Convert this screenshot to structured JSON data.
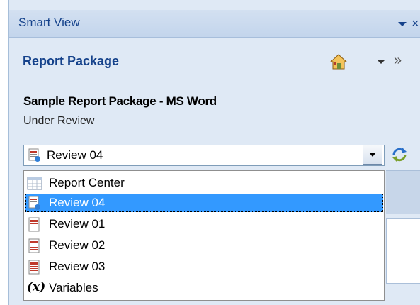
{
  "window": {
    "title": "Smart View",
    "close_glyph": "×"
  },
  "header": {
    "title": "Report Package",
    "more_glyph": "»"
  },
  "package": {
    "name": "Sample Report Package - MS Word",
    "status": "Under Review"
  },
  "combo": {
    "selected": "Review 04"
  },
  "dropdown": {
    "items": [
      {
        "label": "Report Center",
        "icon": "report-center-icon"
      },
      {
        "label": "Review 04",
        "icon": "review-doc-icon",
        "selected": true
      },
      {
        "label": "Review 01",
        "icon": "word-doc-icon"
      },
      {
        "label": "Review 02",
        "icon": "word-doc-icon"
      },
      {
        "label": "Review 03",
        "icon": "word-doc-icon"
      },
      {
        "label": "Variables",
        "icon": "variables-icon"
      }
    ],
    "variables_glyph": "(x)"
  },
  "colors": {
    "selection": "#3399ff",
    "title_text": "#15428b",
    "panel_bg": "#dfe9f5"
  }
}
